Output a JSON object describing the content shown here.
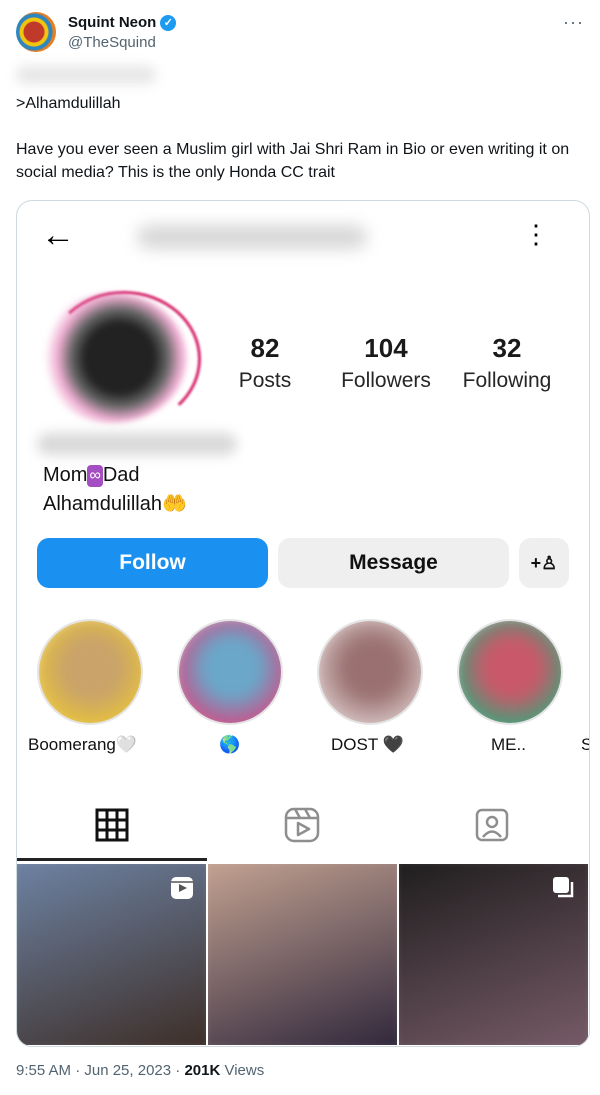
{
  "tweet": {
    "author_name": "Squint Neon",
    "handle": "@TheSquind",
    "more_label": "···",
    "lines": [
      ">Alhamdulillah",
      "Have you ever seen a Muslim girl with Jai Shri Ram in Bio or even writing it on social media? This is the only Honda CC trait"
    ],
    "time": "9:55 AM · Jun 25, 2023 · ",
    "views_count": "201K",
    "views_label": " Views"
  },
  "profile": {
    "back_icon": "←",
    "menu_icon": "⋮",
    "stats": [
      {
        "num": "82",
        "label": "Posts"
      },
      {
        "num": "104",
        "label": "Followers"
      },
      {
        "num": "32",
        "label": "Following"
      }
    ],
    "bio_mom": "Mom",
    "bio_inf": "∞",
    "bio_dad": "Dad",
    "bio_line2": "Alhamdulillah🤲",
    "follow_label": "Follow",
    "message_label": "Message",
    "add_person_label": "+♙",
    "highlights": [
      {
        "label": "Boomerang🤍",
        "colors": [
          "#c9a36a",
          "#e8c33a"
        ]
      },
      {
        "label": "🌎",
        "colors": [
          "#6aa7c9",
          "#d04a82"
        ]
      },
      {
        "label": "DOST 🖤",
        "colors": [
          "#9a7170",
          "#d8c5c5"
        ]
      },
      {
        "label": "ME..",
        "colors": [
          "#c9596a",
          "#3aa37a"
        ]
      },
      {
        "label": "S",
        "colors": [
          "#ffffff",
          "#ffffff"
        ]
      }
    ],
    "tabs": [
      "grid-icon",
      "reels-icon",
      "tagged-icon"
    ],
    "posts": [
      {
        "colors": [
          "#6f86a8",
          "#3b2a22"
        ],
        "icon": "reel-icon"
      },
      {
        "colors": [
          "#c9a795",
          "#2a2238"
        ],
        "icon": ""
      },
      {
        "colors": [
          "#1b1b1b",
          "#7a5d6a"
        ],
        "icon": "carousel-icon"
      }
    ]
  }
}
